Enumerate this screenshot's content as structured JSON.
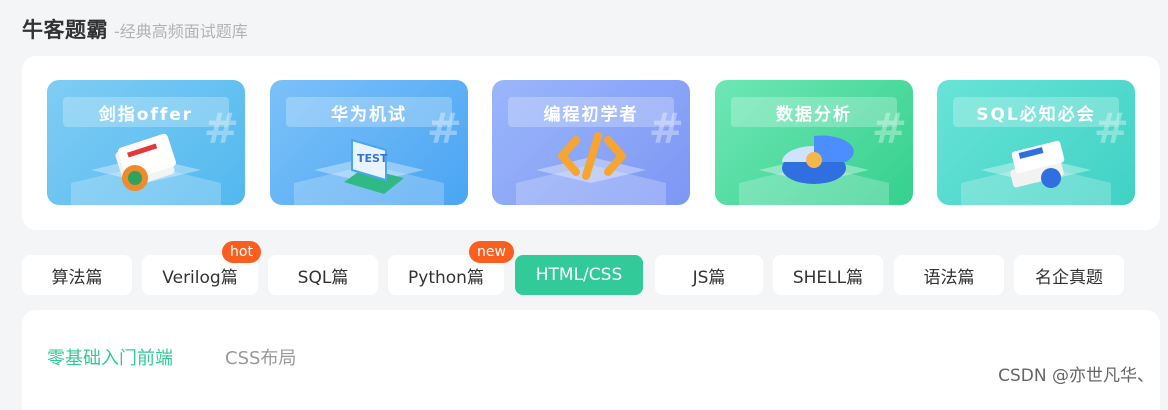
{
  "header": {
    "title": "牛客题霸",
    "subtitle": "-经典高频面试题库"
  },
  "cards": [
    {
      "label": "剑指offer",
      "icon": "book-icon",
      "gradient": [
        "#7fcdf4",
        "#52b8ef"
      ]
    },
    {
      "label": "华为机试",
      "icon": "laptop-icon",
      "gradient": [
        "#7cc1f8",
        "#4aa5f3"
      ]
    },
    {
      "label": "编程初学者",
      "icon": "code-icon",
      "gradient": [
        "#9bb6fb",
        "#7d97f4"
      ]
    },
    {
      "label": "数据分析",
      "icon": "pie-chart-icon",
      "gradient": [
        "#6ee7b5",
        "#35d08d"
      ]
    },
    {
      "label": "SQL必知必会",
      "icon": "book-stack-icon",
      "gradient": [
        "#68e3d7",
        "#3fd2c4"
      ]
    }
  ],
  "tabs": [
    {
      "label": "算法篇"
    },
    {
      "label": "Verilog篇",
      "badge": "hot"
    },
    {
      "label": "SQL篇"
    },
    {
      "label": "Python篇",
      "badge": "new"
    },
    {
      "label": "HTML/CSS",
      "active": true
    },
    {
      "label": "JS篇"
    },
    {
      "label": "SHELL篇"
    },
    {
      "label": "语法篇"
    },
    {
      "label": "名企真题"
    }
  ],
  "subtabs": [
    {
      "label": "零基础入门前端",
      "active": true
    },
    {
      "label": "CSS布局",
      "active": false
    }
  ],
  "watermark": "CSDN @亦世凡华、",
  "colors": {
    "accent": "#32ca99",
    "badge": "#fa5f20"
  }
}
